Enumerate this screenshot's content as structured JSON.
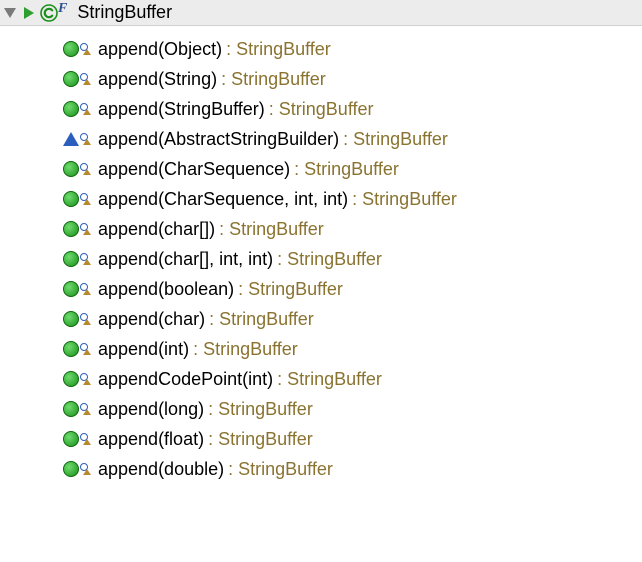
{
  "header": {
    "class_name": "StringBuffer"
  },
  "methods": [
    {
      "vis": "public",
      "sig": "append(Object)",
      "ret": ": StringBuffer"
    },
    {
      "vis": "public",
      "sig": "append(String)",
      "ret": ": StringBuffer"
    },
    {
      "vis": "public",
      "sig": "append(StringBuffer)",
      "ret": ": StringBuffer"
    },
    {
      "vis": "default",
      "sig": "append(AbstractStringBuilder)",
      "ret": ": StringBuffer"
    },
    {
      "vis": "public",
      "sig": "append(CharSequence)",
      "ret": ": StringBuffer"
    },
    {
      "vis": "public",
      "sig": "append(CharSequence, int, int)",
      "ret": ": StringBuffer"
    },
    {
      "vis": "public",
      "sig": "append(char[])",
      "ret": ": StringBuffer"
    },
    {
      "vis": "public",
      "sig": "append(char[], int, int)",
      "ret": ": StringBuffer"
    },
    {
      "vis": "public",
      "sig": "append(boolean)",
      "ret": ": StringBuffer"
    },
    {
      "vis": "public",
      "sig": "append(char)",
      "ret": ": StringBuffer"
    },
    {
      "vis": "public",
      "sig": "append(int)",
      "ret": ": StringBuffer"
    },
    {
      "vis": "public",
      "sig": "appendCodePoint(int)",
      "ret": ": StringBuffer"
    },
    {
      "vis": "public",
      "sig": "append(long)",
      "ret": ": StringBuffer"
    },
    {
      "vis": "public",
      "sig": "append(float)",
      "ret": ": StringBuffer"
    },
    {
      "vis": "public",
      "sig": "append(double)",
      "ret": ": StringBuffer"
    }
  ]
}
